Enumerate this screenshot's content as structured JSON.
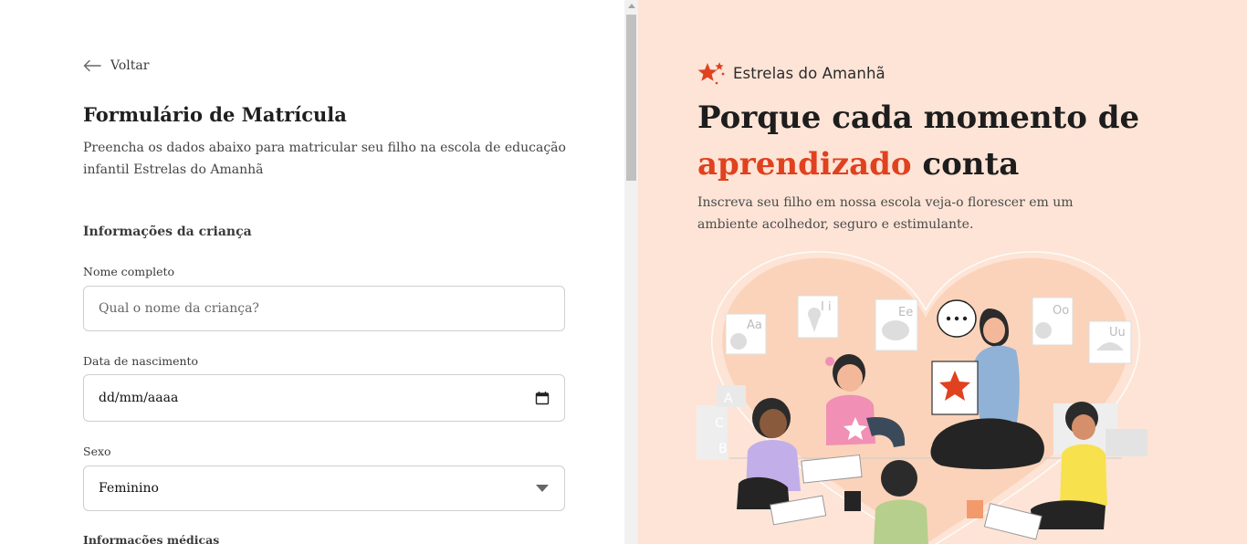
{
  "back": {
    "label": "Voltar"
  },
  "form": {
    "title": "Formulário de Matrícula",
    "subtitle": "Preencha os dados abaixo para matricular seu filho na escola de educação infantil Estrelas do Amanhã",
    "section_child": "Informações da criança",
    "name": {
      "label": "Nome completo",
      "placeholder": "Qual o nome da criança?"
    },
    "birthdate": {
      "label": "Data de nascimento",
      "value": "dd/mm/aaaa"
    },
    "sex": {
      "label": "Sexo",
      "value": "Feminino",
      "options": [
        "Feminino"
      ]
    },
    "section_medical": "Informações médicas"
  },
  "hero": {
    "brand": "Estrelas do Amanhã",
    "title_line1": "Porque cada momento de",
    "title_accent": "aprendizado",
    "title_rest": " conta",
    "subtitle": "Inscreva seu filho em nossa escola veja-o florescer em um ambiente acolhedor, seguro e estimulante."
  },
  "illustration": {
    "cards": [
      "Aa",
      "I i",
      "Ee",
      "Oo",
      "Uu"
    ],
    "blocks": [
      "A",
      "C",
      "B"
    ]
  },
  "colors": {
    "accent": "#e0411f",
    "panel": "#fde4d6",
    "border": "#cfcfcf"
  },
  "icons": {
    "back": "arrow-left-icon",
    "calendar": "calendar-icon",
    "dropdown": "caret-down-icon",
    "brand": "stars-logo-icon"
  }
}
